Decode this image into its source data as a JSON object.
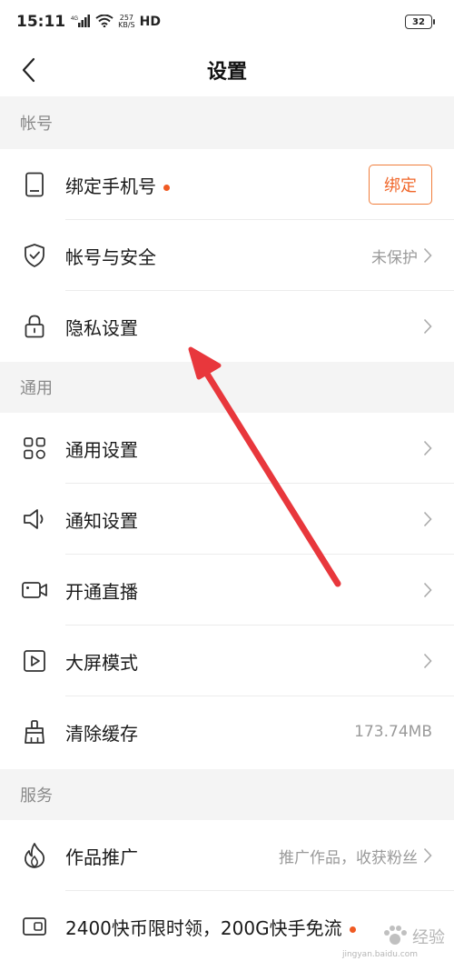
{
  "status_bar": {
    "time": "15:11",
    "network": "4G",
    "speed_value": "257",
    "speed_unit": "KB/S",
    "hd": "HD",
    "battery": "32"
  },
  "header": {
    "title": "设置"
  },
  "sections": {
    "account": "帐号",
    "general": "通用",
    "services": "服务"
  },
  "rows": {
    "bind_phone": {
      "label": "绑定手机号",
      "button": "绑定",
      "icon": "phone-icon"
    },
    "account_security": {
      "label": "帐号与安全",
      "value": "未保护",
      "icon": "shield-icon"
    },
    "privacy": {
      "label": "隐私设置",
      "icon": "lock-icon"
    },
    "general_settings": {
      "label": "通用设置",
      "icon": "grid-icon"
    },
    "notification": {
      "label": "通知设置",
      "icon": "speaker-icon"
    },
    "live": {
      "label": "开通直播",
      "icon": "camera-icon"
    },
    "big_screen": {
      "label": "大屏模式",
      "icon": "play-icon"
    },
    "clear_cache": {
      "label": "清除缓存",
      "value": "173.74MB",
      "icon": "broom-icon"
    },
    "promotion": {
      "label": "作品推广",
      "value": "推广作品，收获粉丝",
      "icon": "flame-icon"
    },
    "coin_offer": {
      "label": "2400快币限时领，200G快手免流",
      "icon": "card-icon"
    }
  },
  "watermark": {
    "text": "经验",
    "sub": "jingyan.baidu.com"
  },
  "colors": {
    "accent": "#f0672a",
    "dot": "#f05a23",
    "arrow": "#e8373c",
    "section_bg": "#f4f4f4"
  }
}
